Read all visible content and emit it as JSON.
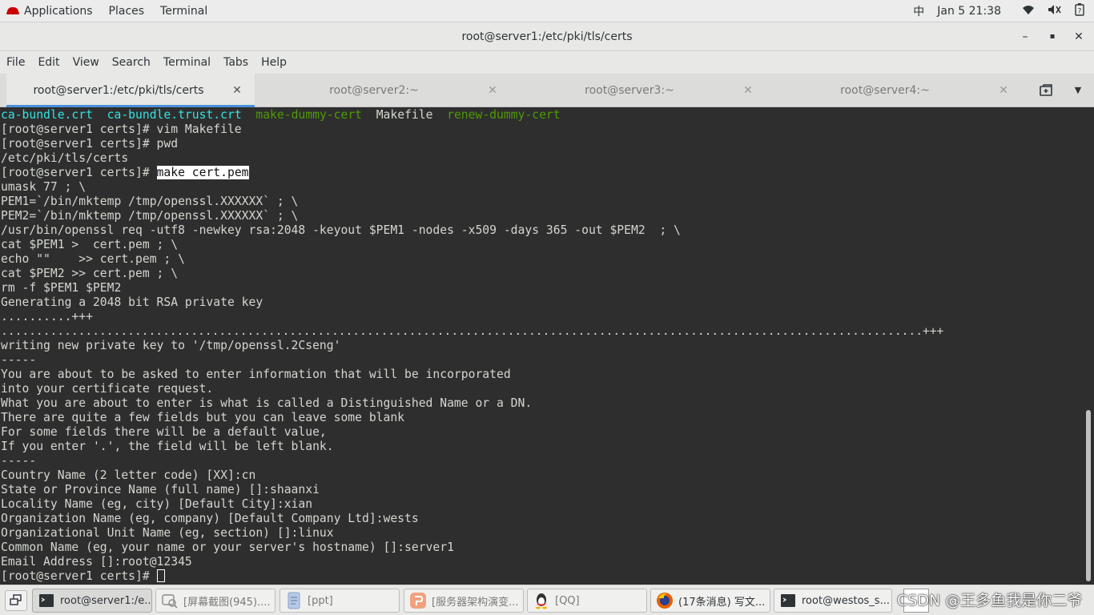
{
  "topbar": {
    "applications": "Applications",
    "places": "Places",
    "terminal": "Terminal",
    "input_method": "中",
    "clock": "Jan 5  21:38"
  },
  "window": {
    "title": "root@server1:/etc/pki/tls/certs",
    "minimize_glyph": "–",
    "maximize_glyph": "▪",
    "close_glyph": "✕"
  },
  "menu": [
    "File",
    "Edit",
    "View",
    "Search",
    "Terminal",
    "Tabs",
    "Help"
  ],
  "tabs": [
    {
      "label": "root@server1:/etc/pki/tls/certs",
      "active": true
    },
    {
      "label": "root@server2:~",
      "active": false
    },
    {
      "label": "root@server3:~",
      "active": false
    },
    {
      "label": "root@server4:~",
      "active": false
    }
  ],
  "terminal": {
    "ls_line": {
      "f1": "ca-bundle.crt",
      "f2": "ca-bundle.trust.crt",
      "f3": "make-dummy-cert",
      "f4": "Makefile",
      "f5": "renew-dummy-cert"
    },
    "prompt": "[root@server1 certs]# ",
    "highlighted_command": "make cert.pem",
    "lines": [
      "[root@server1 certs]# vim Makefile",
      "[root@server1 certs]# pwd",
      "/etc/pki/tls/certs",
      "umask 77 ; \\",
      "PEM1=`/bin/mktemp /tmp/openssl.XXXXXX` ; \\",
      "PEM2=`/bin/mktemp /tmp/openssl.XXXXXX` ; \\",
      "/usr/bin/openssl req -utf8 -newkey rsa:2048 -keyout $PEM1 -nodes -x509 -days 365 -out $PEM2  ; \\",
      "cat $PEM1 >  cert.pem ; \\",
      "echo \"\"    >> cert.pem ; \\",
      "cat $PEM2 >> cert.pem ; \\",
      "rm -f $PEM1 $PEM2",
      "Generating a 2048 bit RSA private key",
      "..........+++",
      "...................................................................................................................................+++",
      "writing new private key to '/tmp/openssl.2Cseng'",
      "-----",
      "You are about to be asked to enter information that will be incorporated",
      "into your certificate request.",
      "What you are about to enter is what is called a Distinguished Name or a DN.",
      "There are quite a few fields but you can leave some blank",
      "For some fields there will be a default value,",
      "If you enter '.', the field will be left blank.",
      "-----",
      "Country Name (2 letter code) [XX]:cn",
      "State or Province Name (full name) []:shaanxi",
      "Locality Name (eg, city) [Default City]:xian",
      "Organization Name (eg, company) [Default Company Ltd]:wests",
      "Organizational Unit Name (eg, section) []:linux",
      "Common Name (eg, your name or your server's hostname) []:server1",
      "Email Address []:root@12345"
    ]
  },
  "taskbar": {
    "tasks": [
      {
        "label": "root@server1:/e...",
        "icon": "terminal-icon",
        "active": true,
        "faded": false
      },
      {
        "label": "[屏幕截图(945)....",
        "icon": "screenshot-icon",
        "active": false,
        "faded": true
      },
      {
        "label": "[ppt]",
        "icon": "document-icon",
        "active": false,
        "faded": true
      },
      {
        "label": "[服务器架构演变...",
        "icon": "presentation-icon",
        "active": false,
        "faded": true
      },
      {
        "label": "[QQ]",
        "icon": "qq-icon",
        "active": false,
        "faded": true
      },
      {
        "label": "(17条消息) 写文...",
        "icon": "firefox-icon",
        "active": false,
        "faded": false
      },
      {
        "label": "root@westos_s...",
        "icon": "terminal-icon",
        "active": false,
        "faded": false
      }
    ]
  },
  "watermark": "CSDN @王多鱼我是你二爷",
  "colors": {
    "terminal_bg": "#2e2e2e",
    "terminal_fg": "#d3d7cf",
    "ls_cyan": "#34e2e2",
    "ls_green": "#4e9a06",
    "tab_accent": "#4a90d9"
  }
}
